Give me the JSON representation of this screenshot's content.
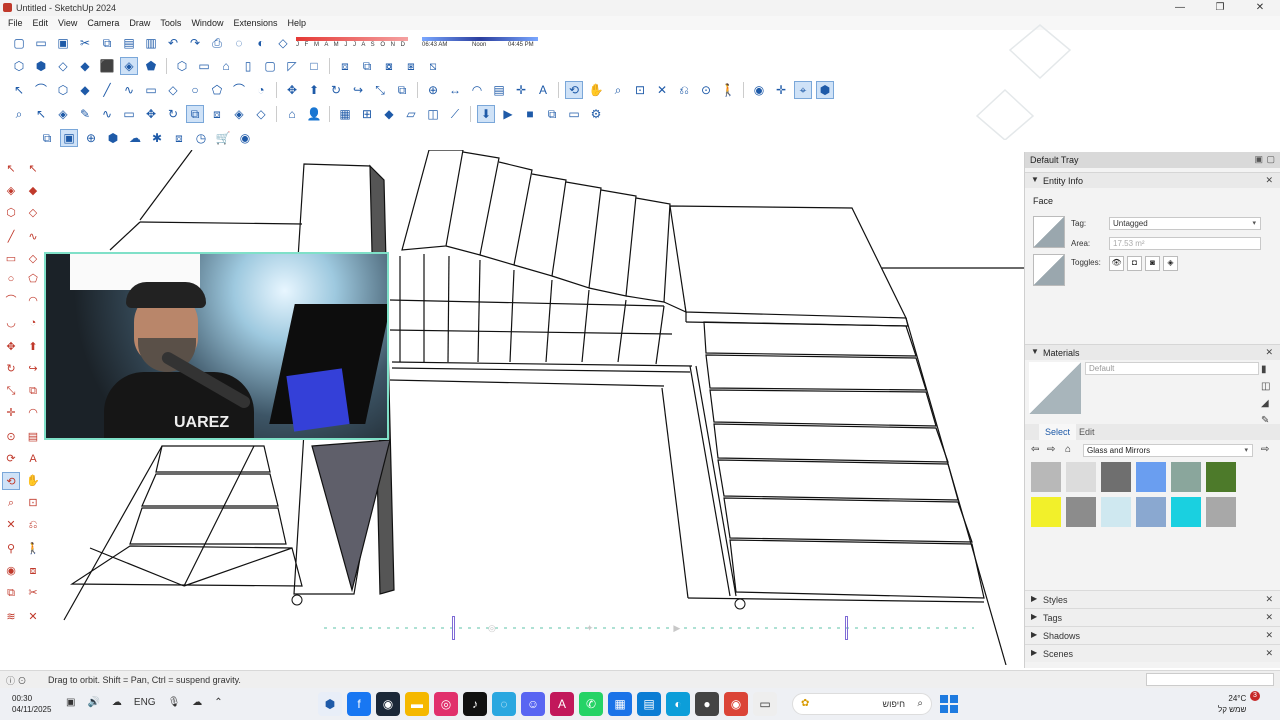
{
  "window": {
    "title": "Untitled - SketchUp 2024",
    "controls": [
      "—",
      "❐",
      "✕"
    ]
  },
  "menu": [
    "File",
    "Edit",
    "View",
    "Camera",
    "Draw",
    "Tools",
    "Window",
    "Extensions",
    "Help"
  ],
  "shadow": {
    "months": "J F M A M J J A S O N D",
    "time_start": "06:43 AM",
    "time_mid": "Noon",
    "time_end": "04:45 PM"
  },
  "tray": {
    "title": "Default Tray",
    "entity_info": {
      "header": "Entity Info",
      "type": "Face",
      "tag_label": "Tag:",
      "tag_value": "Untagged",
      "area_label": "Area:",
      "area_value": "17.53 m²",
      "toggles_label": "Toggles:"
    },
    "materials": {
      "header": "Materials",
      "name": "Default",
      "tab_select": "Select",
      "tab_edit": "Edit",
      "library": "Glass and Mirrors",
      "swatches": [
        "#b8b8b8",
        "#dcdcdc",
        "#6f6f6f",
        "#6a9ef0",
        "#8aa69c",
        "#4d7a2a",
        "#f2f02a",
        "#8c8c8c",
        "#cfe8f0",
        "#8aa8d0",
        "#1ad0e0",
        "#a8a8a8"
      ]
    },
    "bottom_panels": [
      "Styles",
      "Tags",
      "Shadows",
      "Scenes"
    ]
  },
  "status": {
    "hint": "Drag to orbit. Shift = Pan, Ctrl = suspend gravity."
  },
  "webcam_overlay": {
    "shirt_text": "UAREZ"
  },
  "taskbar": {
    "time": "00:30",
    "date": "04/11/2025",
    "lang": "ENG",
    "search_text": "חיפוש",
    "temp": "24°C",
    "weather": "שמש קל",
    "badge": "3"
  }
}
